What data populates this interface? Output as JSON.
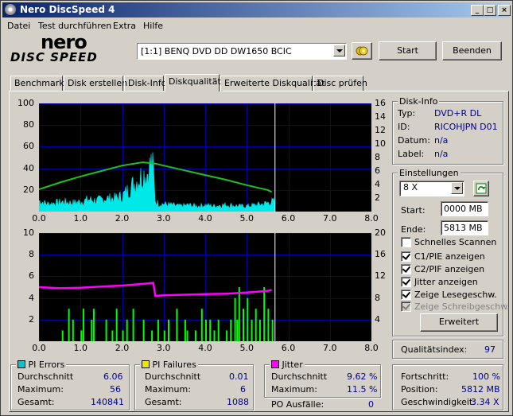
{
  "window": {
    "title": "Nero DiscSpeed 4"
  },
  "menu": [
    "Datei",
    "Test durchführen",
    "Extra",
    "Hilfe"
  ],
  "logo": {
    "line1": "nero",
    "line2": "DISC SPEED"
  },
  "toolbar": {
    "drive": "[1:1]   BENQ DVD DD DW1650 BCIC",
    "start_label": "Start",
    "exit_label": "Beenden"
  },
  "tabs": [
    "Benchmark",
    "Disk erstellen",
    "Disk-Info",
    "Diskqualität",
    "Erweiterte Diskqualität",
    "Disc prüfen"
  ],
  "active_tab": "Diskqualität",
  "disk_info": {
    "title": "Disk-Info",
    "typ_label": "Typ:",
    "typ": "DVD+R DL",
    "id_label": "ID:",
    "id": "RICOHJPN D01",
    "datum_label": "Datum:",
    "datum": "n/a",
    "label_label": "Label:",
    "label": "n/a"
  },
  "settings": {
    "title": "Einstellungen",
    "speed": "8 X",
    "start_label": "Start:",
    "start_value": "0000 MB",
    "end_label": "Ende:",
    "end_value": "5813 MB",
    "checkboxes": [
      {
        "label": "Schnelles Scannen",
        "checked": false,
        "disabled": false
      },
      {
        "label": "C1/PIE anzeigen",
        "checked": true,
        "disabled": false
      },
      {
        "label": "C2/PIF anzeigen",
        "checked": true,
        "disabled": false
      },
      {
        "label": "Jitter anzeigen",
        "checked": true,
        "disabled": false
      },
      {
        "label": "Zeige Lesegeschw.",
        "checked": true,
        "disabled": false
      },
      {
        "label": "Zeige Schreibgeschw.",
        "checked": true,
        "disabled": true
      }
    ],
    "advanced_label": "Erweitert"
  },
  "quality": {
    "label": "Qualitätsindex:",
    "value": "97"
  },
  "pi_errors": {
    "title": "PI Errors",
    "color": "#00c8c8",
    "avg_label": "Durchschnitt",
    "avg": "6.06",
    "max_label": "Maximum:",
    "max": "56",
    "total_label": "Gesamt:",
    "total": "140841"
  },
  "pi_failures": {
    "title": "PI Failures",
    "color": "#e8e800",
    "avg_label": "Durchschnitt",
    "avg": "0.01",
    "max_label": "Maximum:",
    "max": "6",
    "total_label": "Gesamt:",
    "total": "1088"
  },
  "jitter": {
    "title": "Jitter",
    "color": "#ff00ff",
    "avg_label": "Durchschnitt",
    "avg": "9.62 %",
    "max_label": "Maximum:",
    "max": "11.5 %",
    "po_label": "PO Ausfälle:",
    "po": "0"
  },
  "progress": {
    "fortschritt_label": "Fortschritt:",
    "fortschritt": "100 %",
    "position_label": "Position:",
    "position": "5812 MB",
    "speed_label": "Geschwindigkeit:",
    "speed": "3.34 X"
  },
  "chart_data": [
    {
      "type": "area",
      "name": "PI Errors / Read Speed",
      "xlim": [
        0,
        8
      ],
      "ylim_left": [
        0,
        100
      ],
      "ylim_right": [
        0,
        16
      ],
      "x_ticks": [
        "0.0",
        "1.0",
        "2.0",
        "3.0",
        "4.0",
        "5.0",
        "6.0",
        "7.0",
        "8.0"
      ],
      "y_ticks_left": [
        "20",
        "40",
        "60",
        "80",
        "100"
      ],
      "y_ticks_right": [
        "2",
        "4",
        "6",
        "8",
        "10",
        "12",
        "14",
        "16"
      ],
      "scan_end": 5.68,
      "series": [
        {
          "name": "PI Errors",
          "color": "#00e8e8",
          "x": [
            0,
            0.2,
            0.4,
            0.6,
            0.8,
            1.0,
            1.2,
            1.4,
            1.6,
            1.8,
            2.0,
            2.2,
            2.4,
            2.5,
            2.6,
            2.7,
            2.75,
            2.8,
            2.9,
            3.0,
            3.2,
            3.4,
            3.6,
            3.8,
            4.0,
            4.2,
            4.4,
            4.6,
            4.8,
            5.0,
            5.2,
            5.4,
            5.6
          ],
          "y": [
            10,
            7,
            8,
            9,
            8,
            9,
            11,
            10,
            12,
            12,
            14,
            22,
            30,
            34,
            35,
            44,
            38,
            9,
            7,
            7,
            6,
            5,
            6,
            5,
            6,
            5,
            6,
            6,
            5,
            5,
            6,
            7,
            9
          ]
        },
        {
          "name": "Lesegeschw.",
          "color": "#20c020",
          "x": [
            0,
            0.5,
            1.0,
            1.5,
            2.0,
            2.5,
            2.8,
            3.0,
            3.5,
            4.0,
            4.5,
            5.0,
            5.5,
            5.6
          ],
          "y": [
            3.3,
            4.3,
            5.2,
            6.0,
            6.8,
            7.3,
            7.1,
            6.8,
            6.1,
            5.4,
            4.7,
            3.9,
            3.2,
            2.9
          ]
        }
      ]
    },
    {
      "type": "bar",
      "name": "PI Failures / Jitter",
      "xlim": [
        0,
        8
      ],
      "ylim_left": [
        0,
        10
      ],
      "ylim_right": [
        0,
        20
      ],
      "x_ticks": [
        "0.0",
        "1.0",
        "2.0",
        "3.0",
        "4.0",
        "5.0",
        "6.0",
        "7.0",
        "8.0"
      ],
      "y_ticks_left": [
        "2",
        "4",
        "6",
        "8",
        "10"
      ],
      "y_ticks_right": [
        "4",
        "8",
        "12",
        "16",
        "20"
      ],
      "scan_end": 5.68,
      "series": [
        {
          "name": "PI Failures",
          "color": "#00ff00",
          "x": [
            0.55,
            0.7,
            0.8,
            1.0,
            1.05,
            1.25,
            1.3,
            1.6,
            1.75,
            1.85,
            2.0,
            2.1,
            2.25,
            2.5,
            2.7,
            2.85,
            3.0,
            3.1,
            3.3,
            3.5,
            3.55,
            3.75,
            3.9,
            4.0,
            4.1,
            4.2,
            4.3,
            4.5,
            4.6,
            4.7,
            4.75,
            4.8,
            4.9,
            5.0,
            5.1,
            5.2,
            5.3,
            5.4,
            5.5,
            5.6
          ],
          "y": [
            1,
            3,
            2,
            1,
            3,
            2,
            3,
            2,
            1,
            3,
            1,
            2,
            3,
            2,
            1,
            2,
            1,
            2,
            3,
            2,
            1,
            1,
            3,
            2,
            2,
            1,
            2,
            1,
            2,
            4,
            2,
            5,
            3,
            4,
            2,
            3,
            2,
            5,
            3,
            2
          ]
        },
        {
          "name": "Jitter",
          "color": "#ff00ff",
          "x": [
            0,
            0.5,
            1.0,
            1.5,
            2.0,
            2.5,
            2.75,
            2.8,
            3.0,
            3.5,
            4.0,
            4.5,
            5.0,
            5.5,
            5.6
          ],
          "y": [
            10.0,
            9.8,
            9.9,
            10.1,
            10.3,
            10.6,
            10.8,
            8.4,
            8.5,
            8.6,
            8.7,
            8.8,
            9.0,
            9.3,
            9.5
          ]
        }
      ]
    }
  ]
}
